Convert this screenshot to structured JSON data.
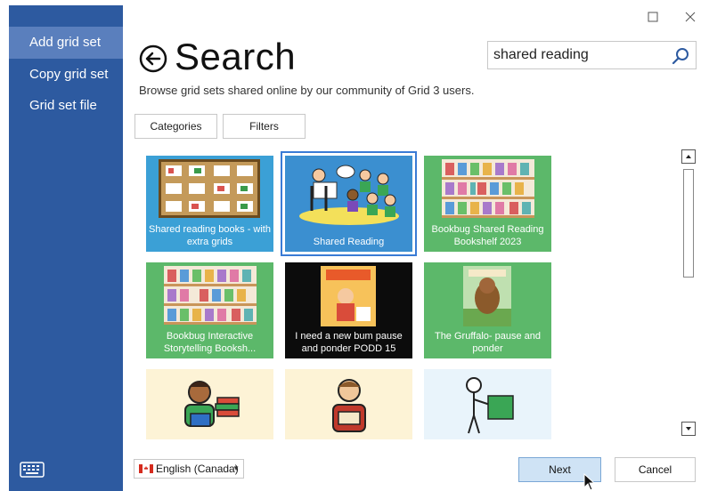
{
  "sidebar": {
    "items": [
      {
        "label": "Add grid set",
        "active": true
      },
      {
        "label": "Copy grid set",
        "active": false
      },
      {
        "label": "Grid set file",
        "active": false
      }
    ],
    "bottom_icon": "keyboard-icon"
  },
  "window": {
    "maximize_icon": "maximize-icon",
    "close_icon": "close-icon"
  },
  "header": {
    "title": "Search",
    "subtitle": "Browse grid sets shared online by our community of Grid 3 users."
  },
  "search": {
    "value": "shared reading"
  },
  "tabs": {
    "categories": "Categories",
    "filters": "Filters"
  },
  "tiles": [
    {
      "label": "Shared reading books - with extra grids",
      "bg": "#3ba0d6",
      "selected": false
    },
    {
      "label": "Shared Reading",
      "bg": "#3b8fd0",
      "selected": true
    },
    {
      "label": "Bookbug Shared Reading Bookshelf 2023",
      "bg": "#5cb86a",
      "selected": false
    },
    {
      "label": "Bookbug Interactive Storytelling Booksh...",
      "bg": "#5cb86a",
      "selected": false
    },
    {
      "label": "I need a new bum pause and ponder  PODD 15",
      "bg": "#0c0c0c",
      "selected": false
    },
    {
      "label": "The Gruffalo- pause and ponder",
      "bg": "#5cb86a",
      "selected": false
    },
    {
      "label": "",
      "bg": "#fdf3d6",
      "selected": false
    },
    {
      "label": "",
      "bg": "#fdf3d6",
      "selected": false
    },
    {
      "label": "",
      "bg": "#e9f4fb",
      "selected": false
    }
  ],
  "language": {
    "label": "English (Canada)"
  },
  "buttons": {
    "next": "Next",
    "cancel": "Cancel"
  },
  "colors": {
    "sidebar": "#2d5aa0",
    "sidebar_active": "#5a7fbd",
    "next_button": "#cfe3f5"
  }
}
